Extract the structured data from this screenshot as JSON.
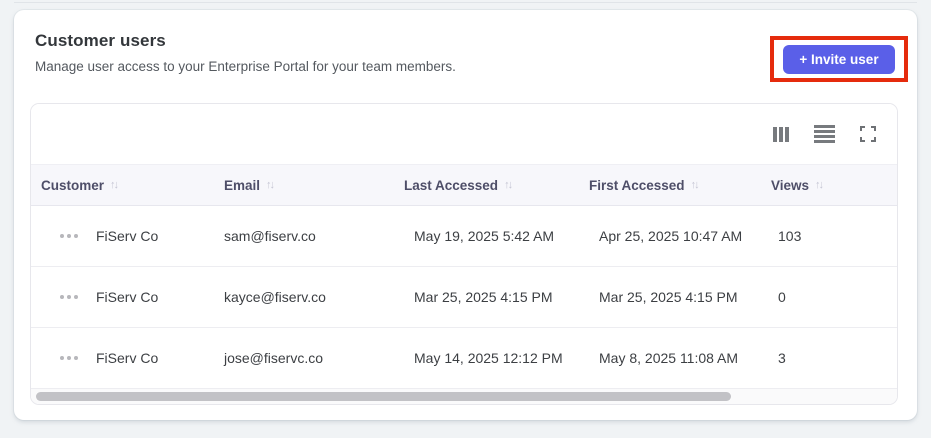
{
  "page": {
    "title": "Customer users",
    "subtitle": "Manage user access to your Enterprise Portal for your team members."
  },
  "invite": {
    "label": "+ Invite user"
  },
  "colors": {
    "accent": "#5a5fe8",
    "annotation": "#e52b0d",
    "header_bg": "#f7f7fb",
    "page_bg": "#f0f3f5"
  },
  "icons": {
    "sort_glyph": "↑↓",
    "toolbar": [
      "columns-icon",
      "row-density-icon",
      "fullscreen-icon"
    ]
  },
  "table": {
    "columns": [
      {
        "label": "Customer"
      },
      {
        "label": "Email"
      },
      {
        "label": "Last Accessed"
      },
      {
        "label": "First Accessed"
      },
      {
        "label": "Views"
      }
    ],
    "rows": [
      {
        "customer": "FiServ Co",
        "email": "sam@fiserv.co",
        "last_accessed": "May 19, 2025 5:42 AM",
        "first_accessed": "Apr 25, 2025 10:47 AM",
        "views": "103"
      },
      {
        "customer": "FiServ Co",
        "email": "kayce@fiserv.co",
        "last_accessed": "Mar 25, 2025 4:15 PM",
        "first_accessed": "Mar 25, 2025 4:15 PM",
        "views": "0"
      },
      {
        "customer": "FiServ Co",
        "email": "jose@fiservc.co",
        "last_accessed": "May 14, 2025 12:12 PM",
        "first_accessed": "May 8, 2025 11:08 AM",
        "views": "3"
      }
    ]
  }
}
